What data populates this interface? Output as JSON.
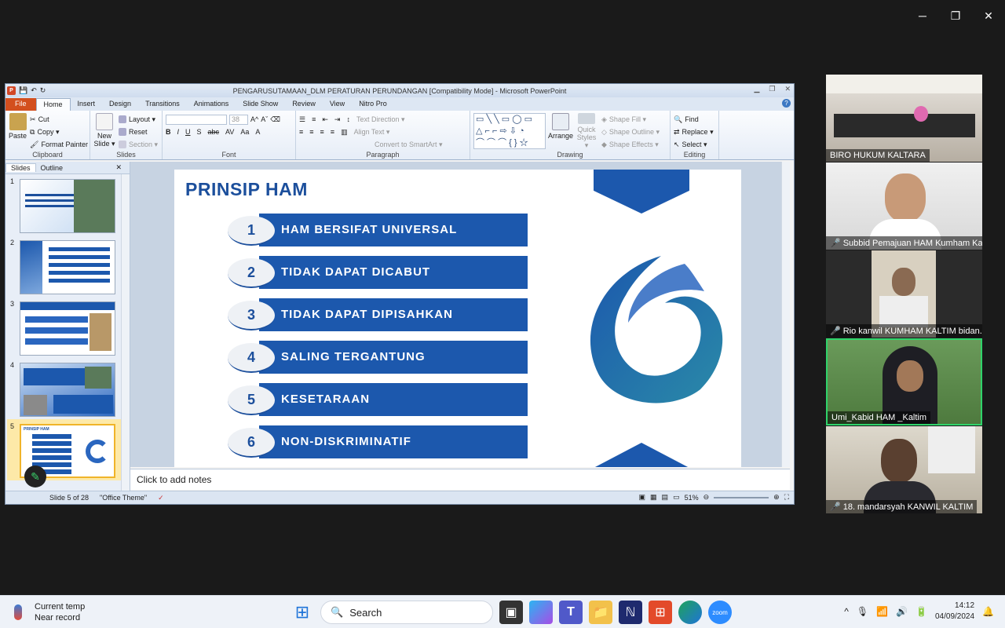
{
  "powerpoint": {
    "title": "PENGARUSUTAMAAN_DLM PERATURAN PERUNDANGAN [Compatibility Mode]  -  Microsoft PowerPoint",
    "tabs": [
      "File",
      "Home",
      "Insert",
      "Design",
      "Transitions",
      "Animations",
      "Slide Show",
      "Review",
      "View",
      "Nitro Pro"
    ],
    "ribbon": {
      "clipboard": {
        "label": "Clipboard",
        "paste": "Paste",
        "cut": "Cut",
        "copy": "Copy ▾",
        "format_painter": "Format Painter"
      },
      "slides": {
        "label": "Slides",
        "new_slide": "New Slide ▾",
        "layout": "Layout ▾",
        "reset": "Reset",
        "section": "Section ▾"
      },
      "font": {
        "label": "Font",
        "size": "38"
      },
      "paragraph": {
        "label": "Paragraph",
        "text_direction": "Text Direction ▾",
        "align_text": "Align Text ▾",
        "smartart": "Convert to SmartArt ▾"
      },
      "drawing": {
        "label": "Drawing",
        "arrange": "Arrange",
        "quick_styles": "Quick Styles ▾",
        "shape_fill": "Shape Fill ▾",
        "shape_outline": "Shape Outline ▾",
        "shape_effects": "Shape Effects ▾"
      },
      "editing": {
        "label": "Editing",
        "find": "Find",
        "replace": "Replace ▾",
        "select": "Select ▾"
      }
    },
    "pane_tabs": {
      "slides": "Slides",
      "outline": "Outline"
    },
    "thumbnails": [
      "1",
      "2",
      "3",
      "4",
      "5"
    ],
    "slide": {
      "title": "PRINSIP HAM",
      "items": [
        {
          "num": "1",
          "label": "HAM BERSIFAT UNIVERSAL"
        },
        {
          "num": "2",
          "label": "TIDAK DAPAT DICABUT"
        },
        {
          "num": "3",
          "label": "TIDAK DAPAT DIPISAHKAN"
        },
        {
          "num": "4",
          "label": "SALING TERGANTUNG"
        },
        {
          "num": "5",
          "label": "KESETARAAN"
        },
        {
          "num": "6",
          "label": "NON-DISKRIMINATIF"
        }
      ]
    },
    "notes_placeholder": "Click to add notes",
    "status": {
      "slide_info": "Slide 5 of 28",
      "theme": "\"Office Theme\"",
      "zoom": "51%"
    }
  },
  "participants": [
    {
      "name": "BIRO HUKUM KALTARA",
      "muted": false
    },
    {
      "name": "Subbid Pemajuan HAM Kumham Ka...",
      "muted": true
    },
    {
      "name": "Rio kanwil KUMHAM KALTIM bidan...",
      "muted": true
    },
    {
      "name": "Umi_Kabid HAM _Kaltim",
      "muted": false
    },
    {
      "name": "18. mandarsyah KANWIL KALTIM",
      "muted": true
    }
  ],
  "taskbar": {
    "weather_title": "Current temp",
    "weather_sub": "Near record",
    "search_placeholder": "Search",
    "time": "14:12",
    "date": "04/09/2024",
    "zoom_app": "zoom"
  },
  "colors": {
    "slide_blue": "#1c58ad",
    "title_blue": "#1c4f9c",
    "active_speaker": "#2fd36a"
  }
}
